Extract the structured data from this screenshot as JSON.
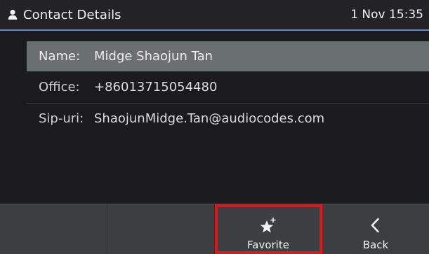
{
  "statusbar": {
    "title": "Contact Details",
    "datetime": "1 Nov 15:35",
    "accent_color": "#5a8fc1",
    "icon": "person-icon"
  },
  "contact": {
    "fields": [
      {
        "label": "Name:",
        "value": "Midge Shaojun  Tan"
      },
      {
        "label": "Office:",
        "value": "+86013715054480"
      },
      {
        "label": "Sip-uri:",
        "value": "ShaojunMidge.Tan@audiocodes.com"
      }
    ],
    "selected_index": 0
  },
  "softkeys": [
    {
      "label": "",
      "icon": ""
    },
    {
      "label": "",
      "icon": ""
    },
    {
      "label": "Favorite",
      "icon": "star-plus-icon",
      "highlight_color": "#e01717"
    },
    {
      "label": "Back",
      "icon": "chevron-left-icon"
    }
  ]
}
